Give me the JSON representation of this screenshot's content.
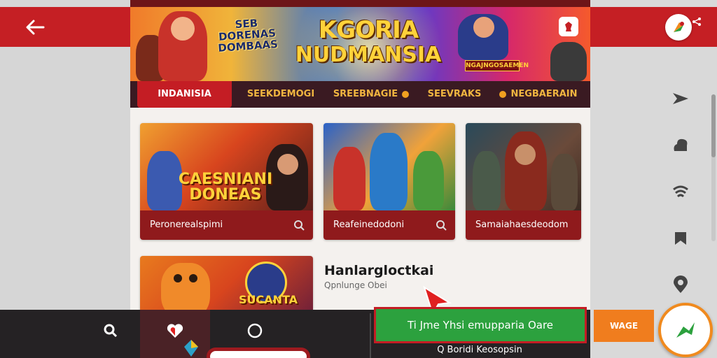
{
  "colors": {
    "brand_red": "#c51f24",
    "dark_maroon": "#3a1a22",
    "tab_gold": "#f0b540",
    "card_footer": "#8f1a1c",
    "cta_green": "#2ca13e",
    "accent_orange": "#f07d1e"
  },
  "header": {
    "back_icon": "arrow-left-icon",
    "logo_icon": "app-logo-icon",
    "share_icon": "share-icon"
  },
  "banner": {
    "subtitle": "SEB DORENAS DOMBAAS",
    "title_line1": "KGORIA",
    "title_line2": "NUDMANSIA",
    "badge": "NGAJNGOSAEMEN",
    "icon": "chess-icon"
  },
  "tabs": [
    {
      "label": "INDANISIA",
      "active": true
    },
    {
      "label": "SEEKDEMOGI",
      "active": false
    },
    {
      "label": "SREEBNAGIE",
      "active": false
    },
    {
      "label": "SEEVRAKS",
      "active": false
    },
    {
      "label": "NEGBAERAIN",
      "active": false
    }
  ],
  "cards": [
    {
      "art_text": "CAESNIANI DONEAS",
      "label": "Peronerealspimi"
    },
    {
      "art_text": "",
      "label": "Reafeinedodoni"
    },
    {
      "art_text": "",
      "label": "Samaiahaesdeodom"
    },
    {
      "art_text": "SUCANTA",
      "label": ""
    }
  ],
  "side_item": {
    "title": "Hanlargloctkai",
    "subtitle": "Qpnlunge Obei"
  },
  "side_icons": [
    "send-icon",
    "cloud-icon",
    "wifi-icon",
    "bookmark-icon",
    "location-icon"
  ],
  "bottom_nav": {
    "search_icon": "search-icon",
    "heart_icon": "heart-icon",
    "circle_icon": "circle-icon",
    "cta_label": "Ti Jme Yhsi emupparia Oare",
    "cta_sub": "Q Boridi Keosopsin",
    "wage_label": "WAGE",
    "fab_icon": "play-arrow-icon"
  }
}
